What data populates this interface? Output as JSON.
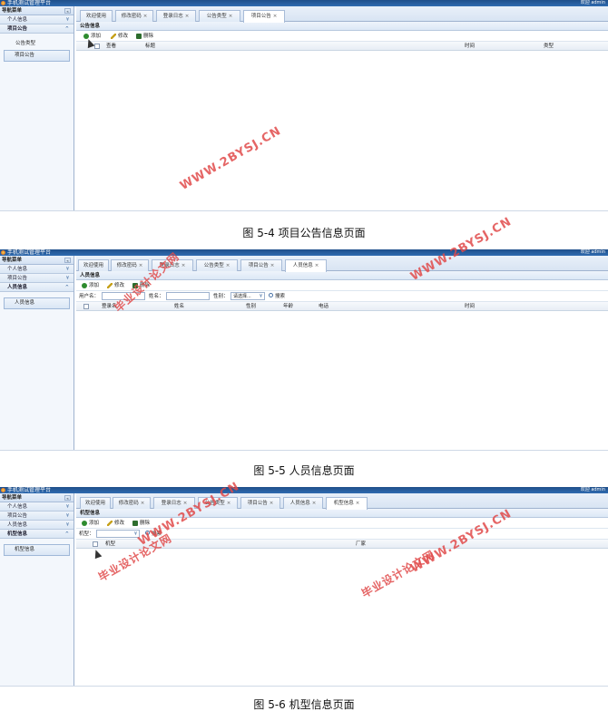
{
  "common": {
    "app_title": "手机测试管理平台",
    "welcome": "欢迎 admin",
    "nav_title": "导航菜单",
    "collapse_glyph": "«",
    "chevron": "¥",
    "chevron_up": "^",
    "tab_close": "×",
    "add": "添加",
    "edit": "修改",
    "delete": "删除",
    "search": "搜索"
  },
  "shot1": {
    "nav_groups": [
      "个人信息",
      "项目公告"
    ],
    "subitems": [
      "公告类型"
    ],
    "selected_subitem": "项目公告",
    "tabs": [
      "欢迎使用",
      "修改密码",
      "登录日志",
      "公告类型",
      "项目公告"
    ],
    "panel_title": "公告信息",
    "columns": [
      "查看",
      "标题",
      "时间",
      "类型"
    ],
    "caption": "图 5-4 项目公告信息页面"
  },
  "shot2": {
    "nav_groups": [
      "个人信息",
      "项目公告",
      "人员信息"
    ],
    "selected_subitem": "人员信息",
    "tabs": [
      "欢迎使用",
      "修改密码",
      "登录日志",
      "公告类型",
      "项目公告",
      "人员信息"
    ],
    "panel_title": "人员信息",
    "search": {
      "username_label": "用户名：",
      "name_label": "姓名：",
      "gender_label": "性别：",
      "gender_value": "请选择..."
    },
    "columns": [
      "登录名",
      "姓名",
      "性别",
      "年龄",
      "电话",
      "时间"
    ],
    "caption": "图 5-5 人员信息页面"
  },
  "shot3": {
    "nav_groups": [
      "个人信息",
      "项目公告",
      "人员信息",
      "机型信息"
    ],
    "selected_subitem": "机型信息",
    "tabs": [
      "欢迎使用",
      "修改密码",
      "登录日志",
      "公告类型",
      "项目公告",
      "人员信息",
      "机型信息"
    ],
    "panel_title": "机型信息",
    "search": {
      "model_label": "机型："
    },
    "columns": [
      "机型",
      "厂家"
    ],
    "caption": "图 5-6 机型信息页面"
  },
  "watermarks": {
    "site": "WWW.2BYSJ.CN",
    "name": "毕业设计论文网"
  },
  "colors": {
    "titlebar": "#2f6bb0",
    "watermark": "#e04a4a",
    "border": "#9fb3cf"
  }
}
